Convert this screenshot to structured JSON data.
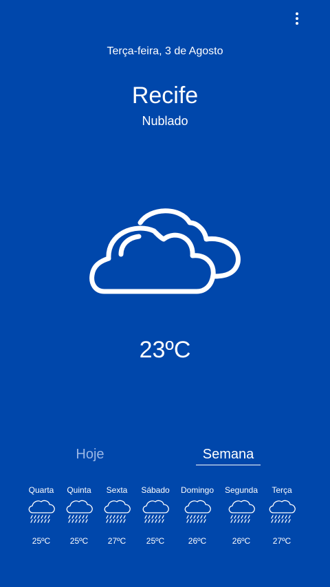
{
  "header": {
    "date": "Terça-feira, 3 de Agosto",
    "city": "Recife",
    "condition": "Nublado",
    "menu_icon": "more-vert-icon"
  },
  "current": {
    "temperature": "23ºC",
    "icon": "cloudy-icon"
  },
  "tabs": [
    {
      "label": "Hoje",
      "active": false
    },
    {
      "label": "Semana",
      "active": true
    }
  ],
  "forecast": [
    {
      "day": "Quarta",
      "temp": "25ºC",
      "icon": "rain-icon"
    },
    {
      "day": "Quinta",
      "temp": "25ºC",
      "icon": "rain-icon"
    },
    {
      "day": "Sexta",
      "temp": "27ºC",
      "icon": "rain-icon"
    },
    {
      "day": "Sábado",
      "temp": "25ºC",
      "icon": "rain-icon"
    },
    {
      "day": "Domingo",
      "temp": "26ºC",
      "icon": "rain-icon"
    },
    {
      "day": "Segunda",
      "temp": "26ºC",
      "icon": "rain-icon"
    },
    {
      "day": "Terça",
      "temp": "27ºC",
      "icon": "rain-icon"
    }
  ],
  "colors": {
    "background": "#0047ab",
    "foreground": "#ffffff",
    "inactive_tab": "#9ab7e6"
  }
}
